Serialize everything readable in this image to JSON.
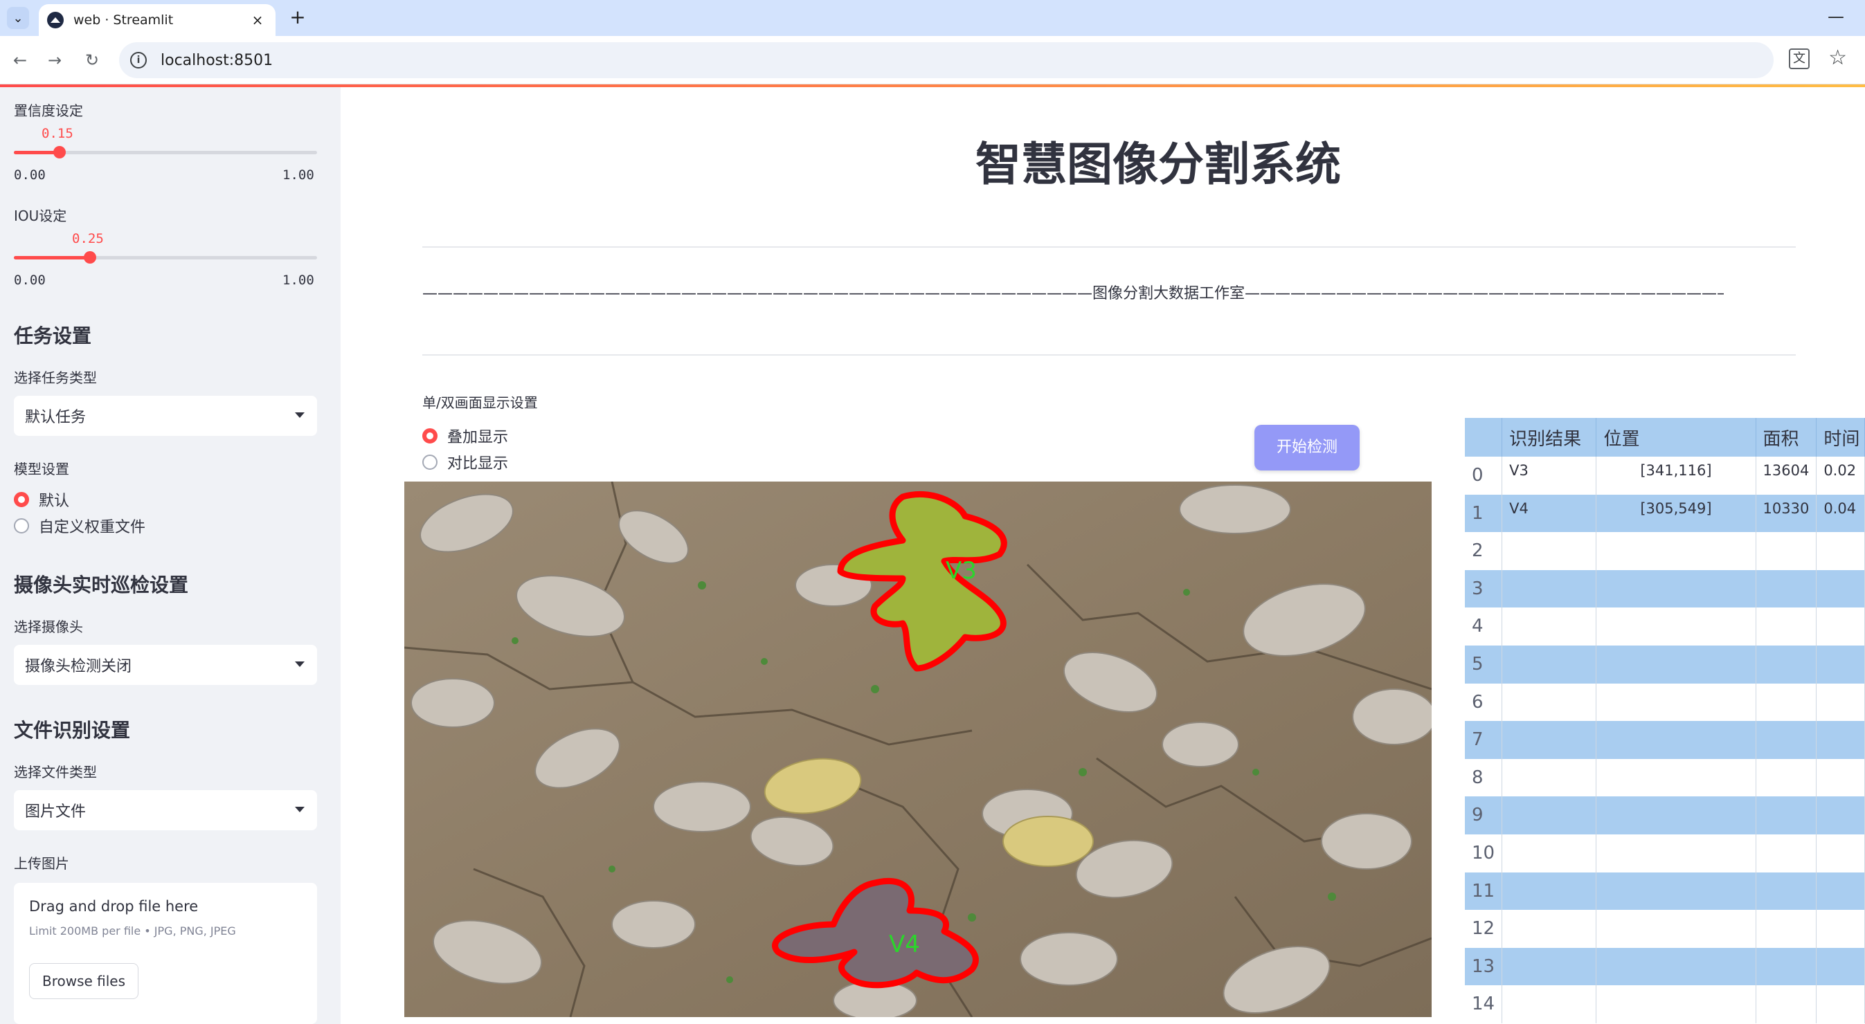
{
  "browser": {
    "tab_title": "web · Streamlit",
    "url": "localhost:8501",
    "new_tab_symbol": "+",
    "close_symbol": "×",
    "minimize_symbol": "—"
  },
  "sidebar": {
    "confidence": {
      "label": "置信度设定",
      "value_text": "0.15",
      "value": 0.15,
      "min": "0.00",
      "max": "1.00"
    },
    "iou": {
      "label": "IOU设定",
      "value_text": "0.25",
      "value": 0.25,
      "min": "0.00",
      "max": "1.00"
    },
    "task_header": "任务设置",
    "task_type_label": "选择任务类型",
    "task_type_value": "默认任务",
    "model_label": "模型设置",
    "model_options": [
      "默认",
      "自定义权重文件"
    ],
    "model_selected": "默认",
    "camera_header": "摄像头实时巡检设置",
    "camera_label": "选择摄像头",
    "camera_value": "摄像头检测关闭",
    "file_header": "文件识别设置",
    "file_type_label": "选择文件类型",
    "file_type_value": "图片文件",
    "upload_label": "上传图片",
    "upload_title": "Drag and drop file here",
    "upload_limit": "Limit 200MB per file • JPG, PNG, JPEG",
    "browse_label": "Browse files"
  },
  "main": {
    "title": "智慧图像分割系统",
    "divider_text": "————————————————————————————————————————————图像分割大数据工作室——————————————————————————————————————————————",
    "display_label": "单/双画面显示设置",
    "display_options": [
      "叠加显示",
      "对比显示"
    ],
    "display_selected": "叠加显示",
    "start_button": "开始检测",
    "detections": [
      {
        "label": "V3",
        "color": "#ff0000",
        "text_color": "#2bd62b"
      },
      {
        "label": "V4",
        "color": "#ff0000",
        "text_color": "#2bd62b"
      }
    ]
  },
  "table": {
    "columns": [
      "",
      "识别结果",
      "位置",
      "面积",
      "时间"
    ],
    "rows": [
      [
        "0",
        "V3",
        "[341,116]",
        "13604",
        "0.02"
      ],
      [
        "1",
        "V4",
        "[305,549]",
        "10330",
        "0.04"
      ],
      [
        "2",
        "",
        "",
        "",
        ""
      ],
      [
        "3",
        "",
        "",
        "",
        ""
      ],
      [
        "4",
        "",
        "",
        "",
        ""
      ],
      [
        "5",
        "",
        "",
        "",
        ""
      ],
      [
        "6",
        "",
        "",
        "",
        ""
      ],
      [
        "7",
        "",
        "",
        "",
        ""
      ],
      [
        "8",
        "",
        "",
        "",
        ""
      ],
      [
        "9",
        "",
        "",
        "",
        ""
      ],
      [
        "10",
        "",
        "",
        "",
        ""
      ],
      [
        "11",
        "",
        "",
        "",
        ""
      ],
      [
        "12",
        "",
        "",
        "",
        ""
      ],
      [
        "13",
        "",
        "",
        "",
        ""
      ],
      [
        "14",
        "",
        "",
        "",
        ""
      ]
    ]
  }
}
